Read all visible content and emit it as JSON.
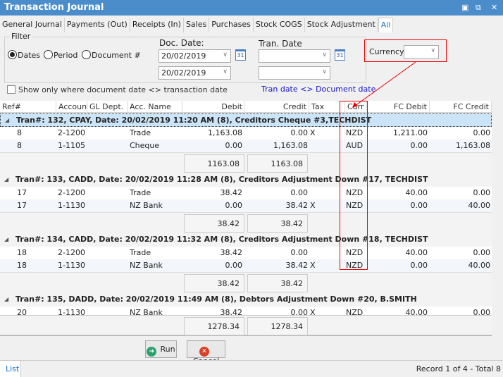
{
  "window": {
    "title": "Transaction Journal",
    "controls": [
      "pin-icon",
      "restore-icon",
      "close-icon"
    ]
  },
  "tabs": [
    {
      "label": "General Journal"
    },
    {
      "label": "Payments (Out)"
    },
    {
      "label": "Receipts (In)"
    },
    {
      "label": "Sales"
    },
    {
      "label": "Purchases"
    },
    {
      "label": "Stock COGS"
    },
    {
      "label": "Stock Adjustment"
    },
    {
      "label": "All",
      "active": true
    }
  ],
  "filter": {
    "title": "Filter",
    "radios": [
      {
        "label": "Dates",
        "checked": true
      },
      {
        "label": "Period",
        "checked": false
      },
      {
        "label": "Document #",
        "checked": false
      }
    ],
    "doc_date_label": "Doc. Date:",
    "doc_date_from": "20/02/2019",
    "doc_date_to": "20/02/2019",
    "tran_date_label": "Tran. Date",
    "tran_date_from": "",
    "tran_date_to": "",
    "calendar_text": "31",
    "currency_label": "Currency",
    "currency_value": "",
    "show_only_label": "Show only where document date <> transaction date",
    "show_only_checked": false,
    "tran_doc_link": "Tran date <> Document date"
  },
  "grid": {
    "columns": [
      "Ref#",
      "Account",
      "GL Dept.",
      "Acc. Name",
      "Debit",
      "Credit",
      "Tax",
      "Curr",
      "FC Debit",
      "FC Credit"
    ],
    "groups": [
      {
        "header": "Tran#: 132, CPAY, Date: 20/02/2019 11:20 AM (8), Creditors Cheque #3,TECHDIST",
        "selected": true,
        "rows": [
          [
            "8",
            "2-1200",
            "",
            "Trade",
            "1,163.08",
            "0.00",
            "X",
            "NZD",
            "1,211.00",
            "0.00"
          ],
          [
            "8",
            "1-1105",
            "",
            "Cheque",
            "0.00",
            "1,163.08",
            "",
            "AUD",
            "0.00",
            "1,163.08"
          ]
        ],
        "debit_total": "1163.08",
        "credit_total": "1163.08"
      },
      {
        "header": "Tran#: 133, CADD, Date: 20/02/2019 11:28 AM (8), Creditors Adjustment Down #17, TECHDIST",
        "rows": [
          [
            "17",
            "2-1200",
            "",
            "Trade",
            "38.42",
            "0.00",
            "",
            "NZD",
            "40.00",
            "0.00"
          ],
          [
            "17",
            "1-1130",
            "",
            "NZ Bank",
            "0.00",
            "38.42",
            "X",
            "NZD",
            "0.00",
            "40.00"
          ]
        ],
        "debit_total": "38.42",
        "credit_total": "38.42"
      },
      {
        "header": "Tran#: 134, CADD, Date: 20/02/2019 11:32 AM (8), Creditors Adjustment Down #18, TECHDIST",
        "rows": [
          [
            "18",
            "2-1200",
            "",
            "Trade",
            "38.42",
            "0.00",
            "",
            "NZD",
            "40.00",
            "0.00"
          ],
          [
            "18",
            "1-1130",
            "",
            "NZ Bank",
            "0.00",
            "38.42",
            "X",
            "NZD",
            "0.00",
            "40.00"
          ]
        ],
        "debit_total": "38.42",
        "credit_total": "38.42"
      },
      {
        "header": "Tran#: 135, DADD, Date: 20/02/2019 11:49 AM (8), Debtors Adjustment Down #20, B.SMITH",
        "rows": [
          [
            "20",
            "1-1130",
            "",
            "NZ Bank",
            "38.42",
            "0.00",
            "X",
            "NZD",
            "40.00",
            "0.00"
          ]
        ]
      }
    ],
    "grand_debit_total": "1278.34",
    "grand_credit_total": "1278.34"
  },
  "buttons": {
    "run": "Run",
    "cancel": "Cancel"
  },
  "status": {
    "tab": "List",
    "record": "Record 1 of 4 - Total 8"
  },
  "colors": {
    "titlebar": "#4b8dcb",
    "annotation": "#ee0000",
    "selected_row": "#cce4f7"
  }
}
